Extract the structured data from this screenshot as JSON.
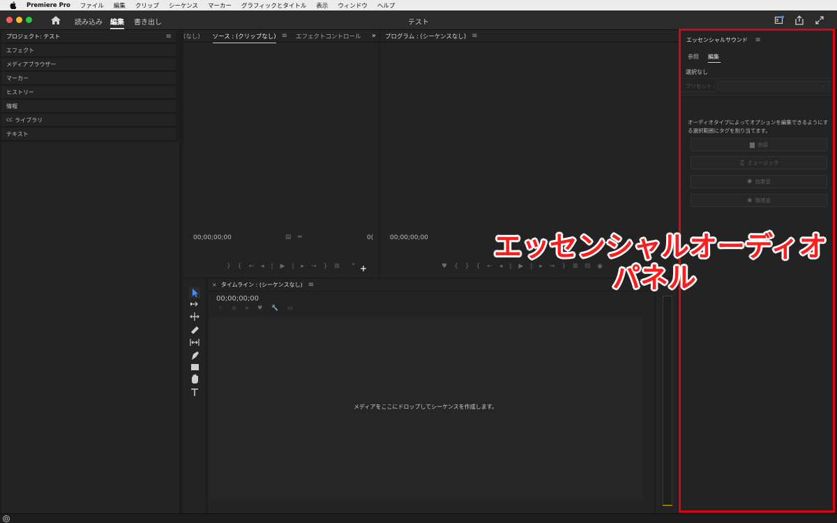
{
  "menubar": {
    "app": "Premiere Pro",
    "items": [
      "ファイル",
      "編集",
      "クリップ",
      "シーケンス",
      "マーカー",
      "グラフィックとタイトル",
      "表示",
      "ウィンドウ",
      "ヘルプ"
    ]
  },
  "titlebar": {
    "title": "テスト",
    "tabs": [
      "読み込み",
      "編集",
      "書き出し"
    ],
    "active_tab": "編集"
  },
  "left_panel": {
    "header": "プロジェクト: テスト",
    "items": [
      "エフェクト",
      "メディアブラウザー",
      "マーカー",
      "ヒストリー",
      "情報",
      "ライブラリ",
      "テキスト"
    ],
    "cc_prefix": "CC"
  },
  "source_panel": {
    "tab_cut": "(なし)",
    "tab_source": "ソース : (クリップなし)",
    "tab_effect": "エフェクトコントロール",
    "timecode": "00;00;00;00",
    "timecode_right": "0("
  },
  "program_panel": {
    "title": "プログラム : (シーケンスなし)",
    "timecode": "00;00;00;00"
  },
  "timeline_panel": {
    "title": "タイムライン : (シーケンスなし)",
    "close": "×",
    "timecode": "00;00;00;00",
    "empty_message": "メディアをここにドロップしてシーケンスを作成します。"
  },
  "essential_sound": {
    "title": "エッセンシャルサウンド",
    "tabs": [
      "参照",
      "編集"
    ],
    "active_tab": "編集",
    "selection": "選択なし",
    "preset_label": "プリセット :",
    "description": "オーディオタイプによってオプションを編集できるようにする選択範囲にタグを割り当てます。",
    "buttons": [
      {
        "label": "会話",
        "icon": "speech-bubble-icon"
      },
      {
        "label": "ミュージック",
        "icon": "music-note-icon"
      },
      {
        "label": "効果音",
        "icon": "burst-icon"
      },
      {
        "label": "環境音",
        "icon": "ambience-icon"
      }
    ]
  },
  "annotation": {
    "line1": "エッセンシャルオーディオ",
    "line2": "パネル",
    "color": "#e00012"
  }
}
